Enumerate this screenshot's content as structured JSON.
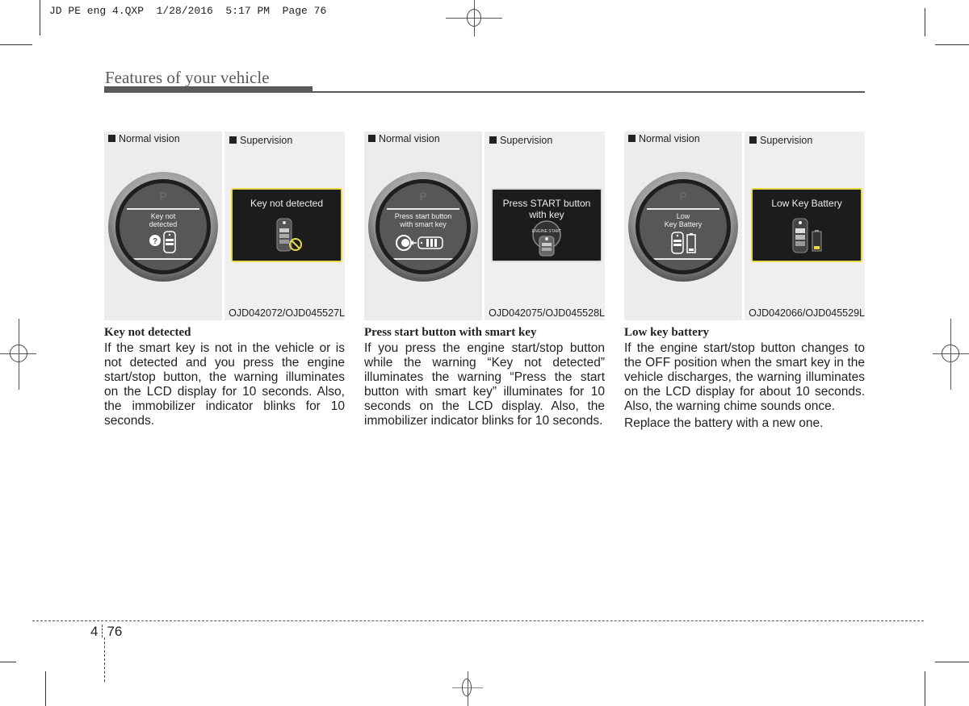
{
  "slug": "JD PE eng 4.QXP  1/28/2016  5:17 PM  Page 76",
  "header": {
    "section_title": "Features of your vehicle"
  },
  "colors": {
    "title_bar": "#5a5a5a",
    "lcd_border_warning": "#e6d84a",
    "lcd_background": "#1c1c1c"
  },
  "figures": [
    {
      "normal_label": "Normal vision",
      "supervision_label": "Supervision",
      "gauge_text": "Key not\ndetected",
      "gauge_icon": "question-key-icon",
      "lcd_text": "Key not detected",
      "lcd_icon": "key-fob-prohibited-icon",
      "code": "OJD042072/OJD045527L"
    },
    {
      "normal_label": "Normal vision",
      "supervision_label": "Supervision",
      "gauge_text": "Press start button\nwith smart key",
      "gauge_icon": "start-button-key-icon",
      "lcd_text": "Press START button\nwith key",
      "lcd_icon": "engine-start-key-icon",
      "lcd_icon_text": "ENGINE START",
      "code": "OJD042075/OJD045528L"
    },
    {
      "normal_label": "Normal vision",
      "supervision_label": "Supervision",
      "gauge_text": "Low\nKey Battery",
      "gauge_icon": "key-low-battery-icon",
      "lcd_text": "Low Key Battery",
      "lcd_icon": "key-low-battery-icon",
      "code": "OJD042066/OJD045529L"
    }
  ],
  "sections": [
    {
      "heading": "Key not detected",
      "paragraphs": [
        "If the smart key is not in the vehicle or is not detected and you press the engine start/stop button, the warning illuminates on the LCD display for 10 seconds. Also, the immobilizer indicator blinks for 10 seconds."
      ]
    },
    {
      "heading": "Press start button with smart key",
      "paragraphs": [
        "If you press the engine start/stop button while the warning “Key not detected” illuminates the warning “Press the start button with smart key” illuminates for 10 seconds on the LCD display. Also, the immobilizer indicator blinks for 10 seconds."
      ]
    },
    {
      "heading": "Low key battery",
      "paragraphs": [
        "If the engine start/stop button changes to the OFF position when the smart key in the vehicle discharges, the warning illuminates on the LCD display for about 10 seconds. Also, the warning chime sounds once.",
        "Replace the battery with a new one."
      ]
    }
  ],
  "footer": {
    "chapter": "4",
    "page": "76"
  }
}
